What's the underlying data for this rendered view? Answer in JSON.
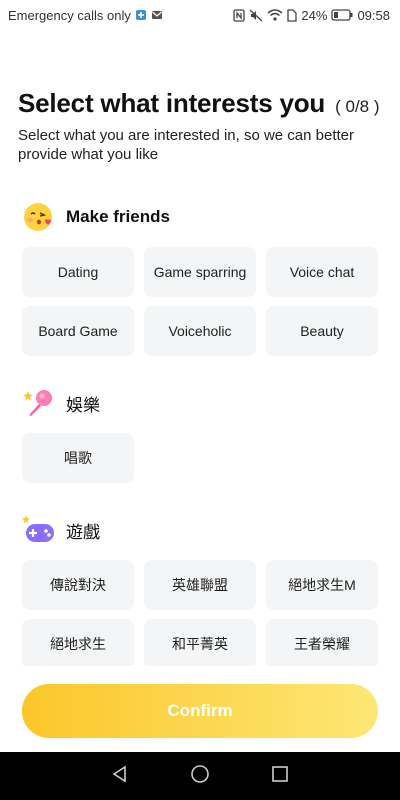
{
  "status_bar": {
    "carrier": "Emergency calls only",
    "battery": "24%",
    "time": "09:58"
  },
  "header": {
    "title": "Select what interests you",
    "counter": "( 0/8 )",
    "subtitle": "Select what you are interested in, so we can better provide what you like"
  },
  "sections": [
    {
      "title": "Make friends",
      "icon": "blowing-kiss-face-icon",
      "chips": [
        "Dating",
        "Game sparring",
        "Voice chat",
        "Board Game",
        "Voiceholic",
        "Beauty"
      ]
    },
    {
      "title": "娛樂",
      "icon": "microphone-icon",
      "chips": [
        "唱歌"
      ]
    },
    {
      "title": "遊戲",
      "icon": "gamepad-icon",
      "chips": [
        "傳說對決",
        "英雄聯盟",
        "絕地求生M",
        "絕地求生",
        "和平菁英",
        "王者榮耀"
      ]
    }
  ],
  "confirm_label": "Confirm",
  "colors": {
    "accent_start": "#fcc62a",
    "accent_end": "#fde775",
    "chip_bg": "#f3f5f6"
  }
}
